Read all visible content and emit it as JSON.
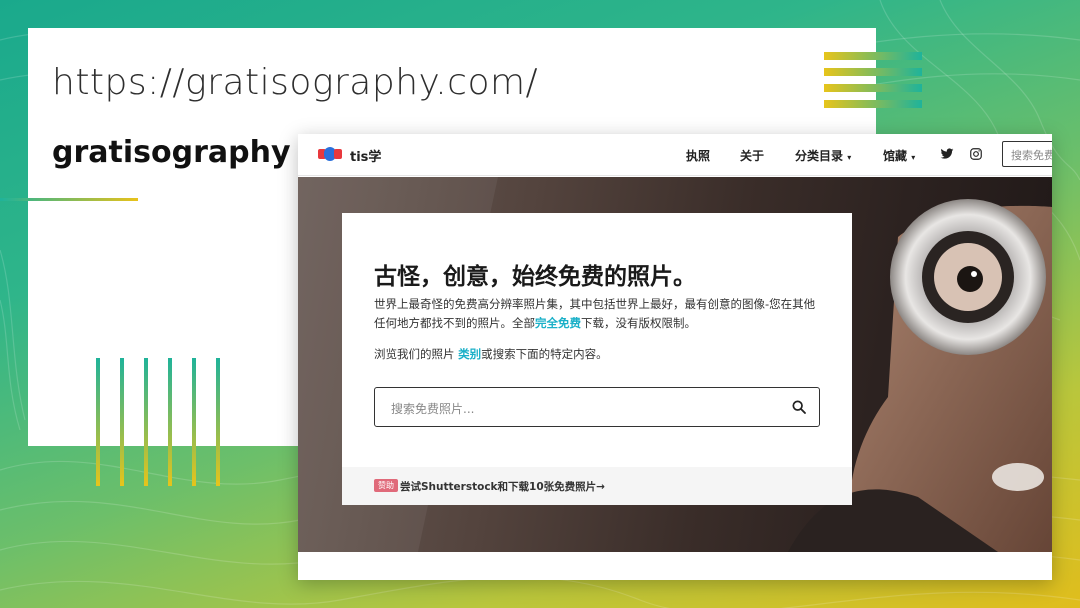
{
  "slide": {
    "url": "https://gratisography.com/",
    "site_name": "gratisography"
  },
  "browser": {
    "logo_text": "tis学",
    "nav": {
      "items": [
        "执照",
        "关于",
        "分类目录",
        "馆藏"
      ],
      "search_placeholder": "搜索免费"
    },
    "hero": {
      "headline": "古怪，创意，始终免费的照片。",
      "desc_part1": "世界上最奇怪的免费高分辨率照片集，其中包括世界上最好，最有创意的图像-您在其他任何地方都找不到的照片。全部",
      "desc_highlight": "完全免费",
      "desc_part2": "下载，没有版权限制。",
      "browse_part1": "浏览我们的照片 ",
      "browse_link": "类别",
      "browse_part2": "或搜索下面的特定内容。",
      "search_placeholder": "搜索免费照片...",
      "promo_badge": "赞助",
      "promo_text": "尝试Shutterstock和下载10张免费照片→"
    }
  },
  "colors": {
    "background_gradient": [
      "#1aa98c",
      "#e0bd1c"
    ],
    "accent_link": "#1ab0c8",
    "logo_red": "#e8383d",
    "logo_blue": "#2a6fdb"
  },
  "icons": [
    "twitter-icon",
    "instagram-icon",
    "search-icon",
    "chevron-down-icon"
  ]
}
